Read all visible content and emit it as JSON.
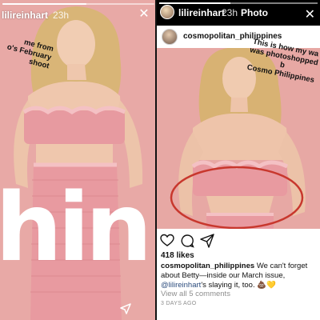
{
  "left_story": {
    "username": "lilireinhart",
    "time": "23h",
    "progress": 0.55,
    "caption_lines": [
      "me from",
      "o's February",
      "shoot"
    ],
    "big_word": "hin"
  },
  "right_story": {
    "username": "lilireinhart",
    "time": "23h",
    "photo_label": "Photo",
    "progress": 0.45,
    "post": {
      "username": "cosmopolitan_philippines",
      "overlay_caption_lines": [
        "This is how my wa",
        "was photoshopped b",
        "Cosmo Philippines"
      ],
      "likes": "418 likes",
      "caption_user": "cosmopolitan_philippines",
      "caption_body": "We can't forget about Betty—inside our March issue,",
      "caption_mention": "@lilireinhart",
      "caption_tail": "'s slaying it, too. 💩💛",
      "view_comments": "View all 5 comments",
      "days_ago": "3 DAYS AGO"
    }
  },
  "icons": {
    "close": "close-icon",
    "send": "send-icon",
    "heart": "heart-icon",
    "comment": "comment-icon",
    "share": "share-icon"
  },
  "colors": {
    "backdrop_pink": "#e8a9a6",
    "highlight_ring": "#c8372d",
    "mention": "#2c4c7d"
  }
}
